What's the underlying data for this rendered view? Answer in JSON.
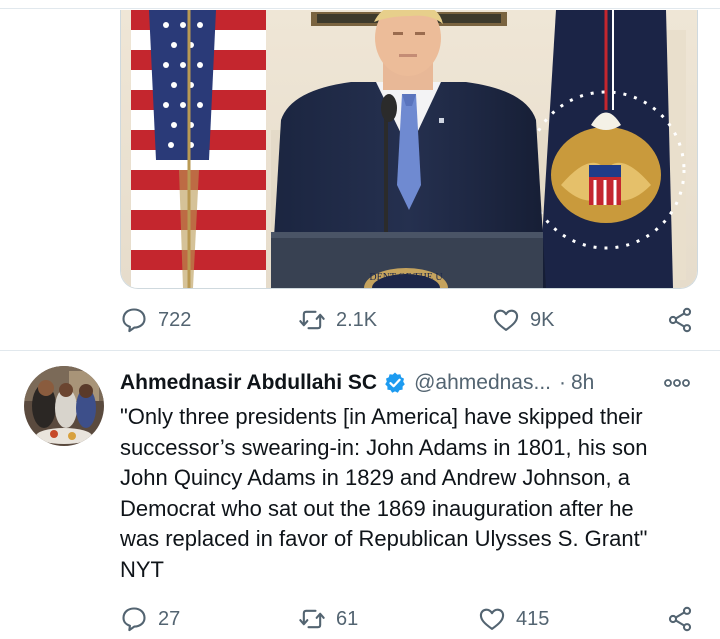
{
  "first_tweet": {
    "stats": {
      "replies": "722",
      "retweets": "2.1K",
      "likes": "9K"
    }
  },
  "second_tweet": {
    "author": {
      "display_name": "Ahmednasir Abdullahi SC",
      "handle": "@ahmednas...",
      "separator": "·",
      "time": "8h"
    },
    "text_lines": [
      "\"Only three presidents [in America] have skipped their",
      "successor’s swearing-in: John Adams in 1801, his son",
      "John Quincy Adams in 1829 and Andrew Johnson, a",
      "Democrat who sat out the 1869 inauguration after he",
      "was replaced in favor of Republican Ulysses S. Grant\"",
      "NYT"
    ],
    "stats": {
      "replies": "27",
      "retweets": "61",
      "likes": "415"
    }
  },
  "media": {
    "seal_text": "DENT OF THE U"
  },
  "icons": [
    "reply-icon",
    "retweet-icon",
    "like-icon",
    "share-icon",
    "verified-badge-icon",
    "more-options-icon"
  ],
  "colors": {
    "text": "#0f1419",
    "secondary": "#536471",
    "verified": "#1d9bf0",
    "divider": "#e1e8ed"
  }
}
